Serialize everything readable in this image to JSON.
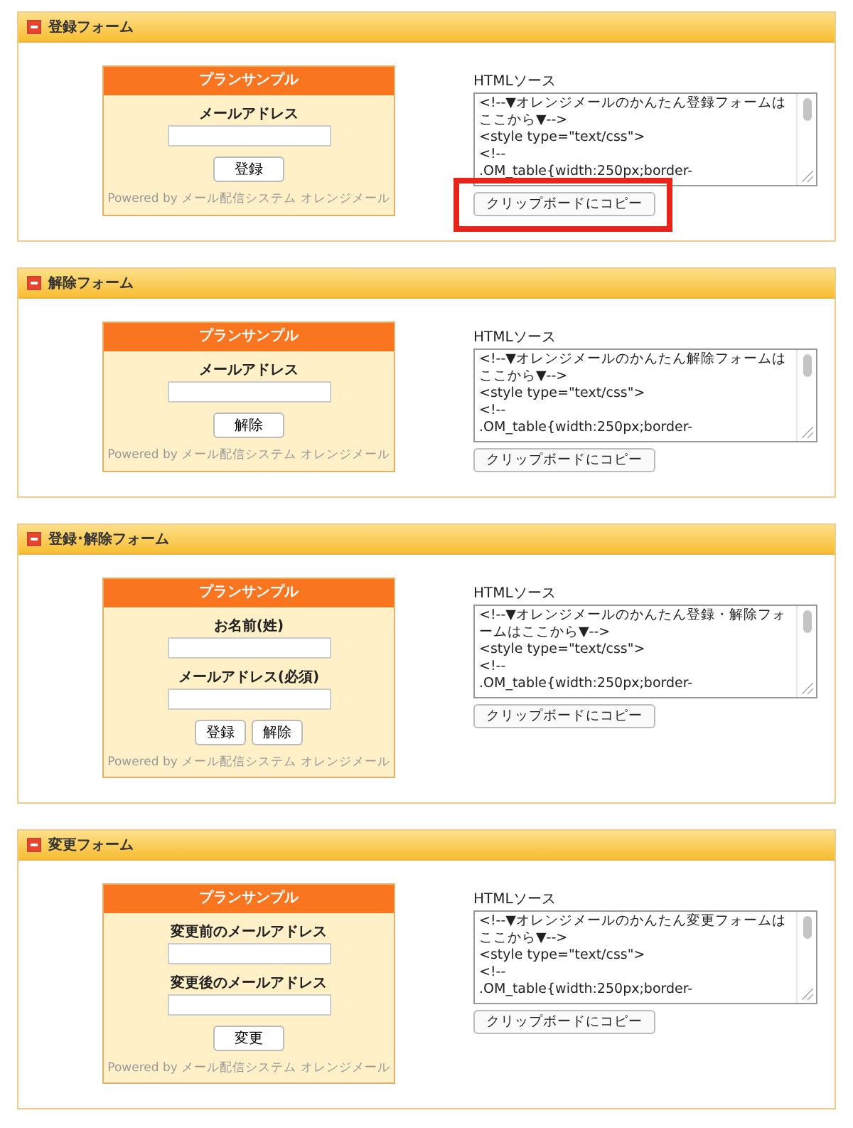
{
  "sections": [
    {
      "title": "登録フォーム",
      "form": {
        "title": "プランサンプル",
        "fields": [
          {
            "label": "メールアドレス"
          }
        ],
        "buttons": [
          "登録"
        ],
        "footer": "Powered by メール配信システム オレンジメール"
      },
      "source": {
        "label": "HTMLソース",
        "lines": [
          "<!--▼オレンジメールのかんたん登録フォームはここから▼-->",
          "<style type=\"text/css\">",
          "<!--",
          ".OM_table{width:250px;border-"
        ],
        "copy_button": {
          "label": "クリップボードにコピー",
          "highlighted": true
        }
      }
    },
    {
      "title": "解除フォーム",
      "form": {
        "title": "プランサンプル",
        "fields": [
          {
            "label": "メールアドレス"
          }
        ],
        "buttons": [
          "解除"
        ],
        "footer": "Powered by メール配信システム オレンジメール"
      },
      "source": {
        "label": "HTMLソース",
        "lines": [
          "<!--▼オレンジメールのかんたん解除フォームはここから▼-->",
          "<style type=\"text/css\">",
          "<!--",
          ".OM_table{width:250px;border-"
        ],
        "copy_button": {
          "label": "クリップボードにコピー",
          "highlighted": false
        }
      }
    },
    {
      "title": "登録･解除フォーム",
      "form": {
        "title": "プランサンプル",
        "fields": [
          {
            "label": "お名前(姓)"
          },
          {
            "label": "メールアドレス(必須)"
          }
        ],
        "buttons": [
          "登録",
          "解除"
        ],
        "footer": "Powered by メール配信システム オレンジメール"
      },
      "source": {
        "label": "HTMLソース",
        "lines": [
          "<!--▼オレンジメールのかんたん登録・解除フォームはここから▼-->",
          "<style type=\"text/css\">",
          "<!--",
          ".OM_table{width:250px;border-"
        ],
        "copy_button": {
          "label": "クリップボードにコピー",
          "highlighted": false
        }
      }
    },
    {
      "title": "変更フォーム",
      "form": {
        "title": "プランサンプル",
        "fields": [
          {
            "label": "変更前のメールアドレス"
          },
          {
            "label": "変更後のメールアドレス"
          }
        ],
        "buttons": [
          "変更"
        ],
        "footer": "Powered by メール配信システム オレンジメール"
      },
      "source": {
        "label": "HTMLソース",
        "lines": [
          "<!--▼オレンジメールのかんたん変更フォームはここから▼-->",
          "<style type=\"text/css\">",
          "<!--",
          ".OM_table{width:250px;border-"
        ],
        "copy_button": {
          "label": "クリップボードにコピー",
          "highlighted": false
        }
      }
    }
  ]
}
